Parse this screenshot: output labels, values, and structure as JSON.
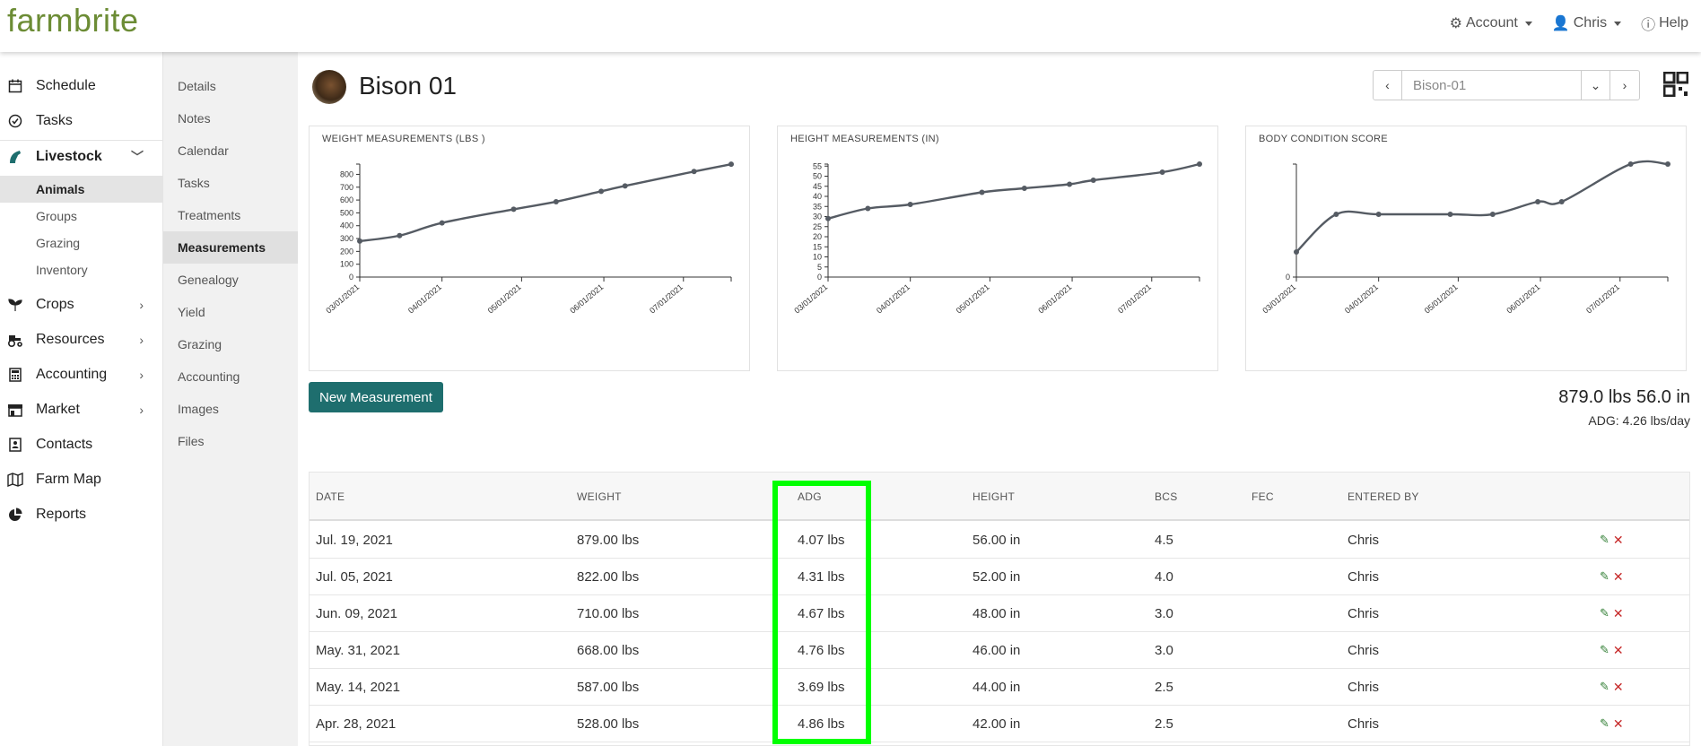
{
  "brand": {
    "logo": "farmbrite",
    "logo_color": "#6c8c35",
    "accent": "#1e6e6e"
  },
  "topnav": {
    "account": "Account",
    "user": "Chris",
    "help": "Help"
  },
  "sidebar": {
    "items": [
      {
        "label": "Schedule",
        "icon": "calendar-icon"
      },
      {
        "label": "Tasks",
        "icon": "check-circle-icon"
      },
      {
        "label": "Livestock",
        "icon": "horse-icon"
      },
      {
        "label": "Crops",
        "icon": "seedling-icon"
      },
      {
        "label": "Resources",
        "icon": "tractor-icon"
      },
      {
        "label": "Accounting",
        "icon": "calculator-icon"
      },
      {
        "label": "Market",
        "icon": "store-icon"
      },
      {
        "label": "Contacts",
        "icon": "contact-card-icon"
      },
      {
        "label": "Farm Map",
        "icon": "map-icon"
      },
      {
        "label": "Reports",
        "icon": "pie-chart-icon"
      }
    ],
    "livestock_sub": [
      "Animals",
      "Groups",
      "Grazing",
      "Inventory"
    ]
  },
  "submenu": [
    "Details",
    "Notes",
    "Calendar",
    "Tasks",
    "Treatments",
    "Measurements",
    "Genealogy",
    "Yield",
    "Grazing",
    "Accounting",
    "Images",
    "Files"
  ],
  "animal": {
    "name": "Bison 01",
    "selector_value": "Bison-01"
  },
  "new_measurement_label": "New Measurement",
  "summary": {
    "line1": "879.0 lbs 56.0 in",
    "line2": "ADG: 4.26 lbs/day"
  },
  "chart_data": [
    {
      "type": "line",
      "title": "WEIGHT MEASUREMENTS (LBS )",
      "x": [
        "2021-03-01",
        "2021-03-16",
        "2021-04-01",
        "2021-04-28",
        "2021-05-14",
        "2021-05-31",
        "2021-06-09",
        "2021-07-05",
        "2021-07-19"
      ],
      "values": [
        280,
        323,
        422,
        528,
        587,
        668,
        710,
        822,
        879
      ],
      "ylim": [
        0,
        880
      ],
      "yticks": [
        0,
        100,
        200,
        300,
        400,
        500,
        600,
        700,
        800
      ],
      "xtick_labels": [
        "03/01/2021",
        "04/01/2021",
        "05/01/2021",
        "06/01/2021",
        "07/01/2021"
      ],
      "xtick_dates": [
        "2021-03-01",
        "2021-04-01",
        "2021-05-01",
        "2021-06-01",
        "2021-07-01"
      ]
    },
    {
      "type": "line",
      "title": "HEIGHT MEASUREMENTS (IN)",
      "x": [
        "2021-03-01",
        "2021-03-16",
        "2021-04-01",
        "2021-04-28",
        "2021-05-14",
        "2021-05-31",
        "2021-06-09",
        "2021-07-05",
        "2021-07-19"
      ],
      "values": [
        29,
        34,
        36,
        42,
        44,
        46,
        48,
        52,
        56
      ],
      "ylim": [
        0,
        56
      ],
      "yticks": [
        0,
        5,
        10,
        15,
        20,
        25,
        30,
        35,
        40,
        45,
        50,
        55
      ],
      "xtick_labels": [
        "03/01/2021",
        "04/01/2021",
        "05/01/2021",
        "06/01/2021",
        "07/01/2021"
      ],
      "xtick_dates": [
        "2021-03-01",
        "2021-04-01",
        "2021-05-01",
        "2021-06-01",
        "2021-07-01"
      ]
    },
    {
      "type": "line",
      "title": "BODY CONDITION SCORE",
      "x": [
        "2021-03-01",
        "2021-03-16",
        "2021-04-01",
        "2021-04-28",
        "2021-05-14",
        "2021-05-31",
        "2021-06-09",
        "2021-07-05",
        "2021-07-19"
      ],
      "values": [
        1.0,
        2.5,
        2.5,
        2.5,
        2.5,
        3.0,
        3.0,
        4.5,
        4.5
      ],
      "ylim": [
        0,
        4.5
      ],
      "yticks": [
        0
      ],
      "xtick_labels": [
        "03/01/2021",
        "04/01/2021",
        "05/01/2021",
        "06/01/2021",
        "07/01/2021"
      ],
      "xtick_dates": [
        "2021-03-01",
        "2021-04-01",
        "2021-05-01",
        "2021-06-01",
        "2021-07-01"
      ]
    }
  ],
  "table": {
    "headers": [
      "DATE",
      "WEIGHT",
      "ADG",
      "HEIGHT",
      "BCS",
      "FEC",
      "ENTERED BY"
    ],
    "rows": [
      [
        "Jul. 19, 2021",
        "879.00 lbs",
        "4.07 lbs",
        "56.00 in",
        "4.5",
        "",
        "Chris"
      ],
      [
        "Jul. 05, 2021",
        "822.00 lbs",
        "4.31 lbs",
        "52.00 in",
        "4.0",
        "",
        "Chris"
      ],
      [
        "Jun. 09, 2021",
        "710.00 lbs",
        "4.67 lbs",
        "48.00 in",
        "3.0",
        "",
        "Chris"
      ],
      [
        "May. 31, 2021",
        "668.00 lbs",
        "4.76 lbs",
        "46.00 in",
        "3.0",
        "",
        "Chris"
      ],
      [
        "May. 14, 2021",
        "587.00 lbs",
        "3.69 lbs",
        "44.00 in",
        "2.5",
        "",
        "Chris"
      ],
      [
        "Apr. 28, 2021",
        "528.00 lbs",
        "4.86 lbs",
        "42.00 in",
        "2.5",
        "",
        "Chris"
      ]
    ]
  }
}
